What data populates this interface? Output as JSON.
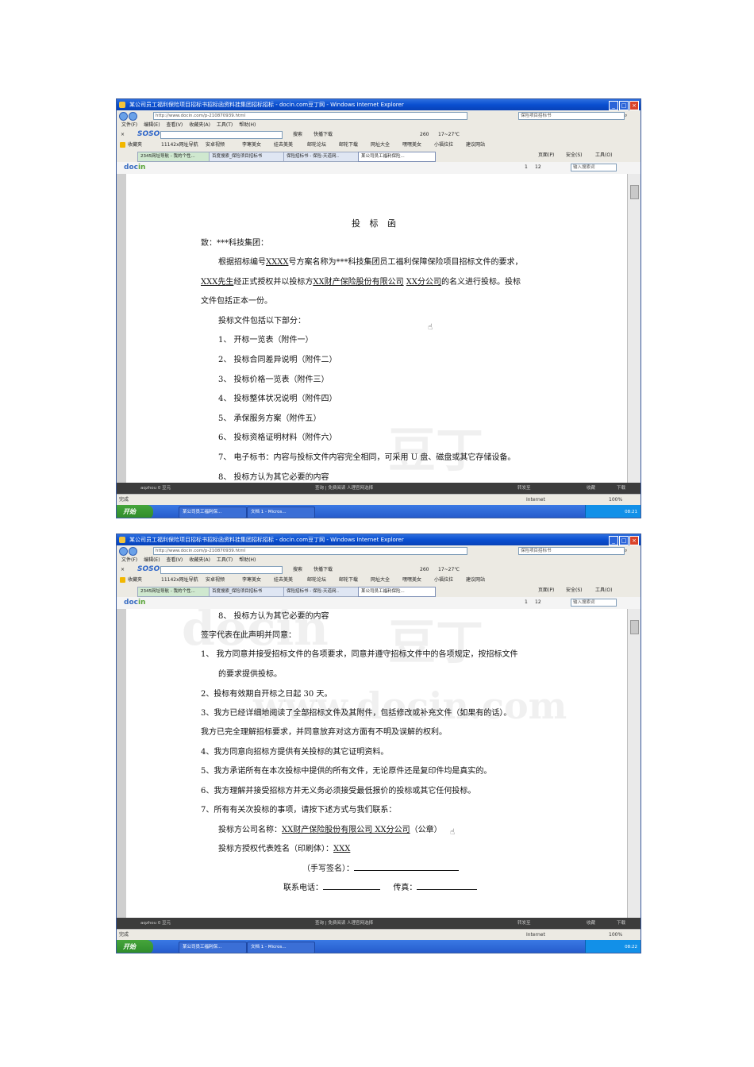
{
  "browser": {
    "title": "某公司员工福利保险项目招标书招标函资料挂集团招标招标 - docin.com豆丁网 - Windows Internet Explorer",
    "address_1": "http://www.docin.com/p-210870939.html",
    "address_2": "http://www.docin.com/p-210870939.html",
    "search_box": "保险项目招标书",
    "menus": [
      "文件(F)",
      "编辑(E)",
      "查看(V)",
      "收藏夹(A)",
      "工具(T)",
      "帮助(H)"
    ],
    "soso_search_label": "搜索",
    "soso_download_label": "快播下载",
    "weather": "17~27℃",
    "count_260": "260",
    "favorites_label": "收藏夹",
    "favorites": [
      "11142x网址导航",
      "安卓视频",
      "李寒美女",
      "娃去美美",
      "邮轮论坛",
      "邮轮下载",
      "网址大全",
      "嘿嘿美女",
      "小福拉拉",
      "建议网站"
    ],
    "tabs": [
      "2345网址导航 - 我的个性...",
      "百度搜索_保险项目招标书",
      "保险招标书 - 保险-天道网..",
      "某公司员工福利保险..."
    ],
    "page_menu": "页面(P)",
    "safety_menu": "安全(S)",
    "tools_menu": "工具(O)",
    "page_indicator_1": "1",
    "page_total": "12",
    "search_keyword_placeholder": "输入搜索词",
    "bottom_user": "aqzhou 0 豆元",
    "bottom_center": "查询 | 免费阅读 人理官网选择",
    "bottom_right_1": "转发至",
    "bottom_right_2": "收藏",
    "bottom_right_3": "下载",
    "status_done": "完成",
    "status_internet": "Internet",
    "zoom": "100%",
    "start_label": "开始",
    "task_1": "某公司员工福利保...",
    "task_2": "文档 1 - Micros...",
    "clock_1": "08:21",
    "clock_2": "08:22"
  },
  "doc_page_1": {
    "title": "投 标 函",
    "salutation": "致：***科技集团：",
    "para1_a": "根据招标编号",
    "para1_code": "XXXX",
    "para1_b": "号方案名称为***科技集团员工福利保障保险项目招标文件的要求，",
    "para2_person": "XXX先生",
    "para2_mid": "经正式授权并以投标方",
    "para2_company": "XX财产保险股份有限公司",
    "para2_branch": "XX分公司",
    "para2_end": "的名义进行投标。投标",
    "para3": "文件包括正本一份。",
    "list_intro": "投标文件包括以下部分：",
    "items": [
      "1、 开标一览表（附件一）",
      "2、 投标合同差异说明（附件二）",
      "3、 投标价格一览表（附件三）",
      "4、 投标整体状况说明（附件四）",
      "5、 承保服务方案（附件五）",
      "6、 投标资格证明材料（附件六）",
      "7、 电子标书：内容与投标文件内容完全相同，可采用 U 盘、磁盘或其它存储设备。",
      "8、 投标方认为其它必要的内容"
    ]
  },
  "doc_page_2": {
    "item8": "8、 投标方认为其它必要的内容",
    "sign_intro": "签字代表在此声明并同意：",
    "c1a": "1、 我方同意并接受招标文件的各项要求，同意并遵守招标文件中的各项规定，按招标文件",
    "c1b": "的要求提供投标。",
    "c2": "2、投标有效期自开标之日起 30 天。",
    "c3a": "3、我方已经详细地阅读了全部招标文件及其附件，包括修改或补充文件（如果有的话）。",
    "c3b": "我方已完全理解招标要求，并同意放弃对这方面有不明及误解的权利。",
    "c4": "4、我方同意向招标方提供有关投标的其它证明资料。",
    "c5": "5、我方承诺所有在本次投标中提供的所有文件，无论原件还是复印件均是真实的。",
    "c6": "6、我方理解并接受招标方并无义务必须接受最低报价的投标或其它任何投标。",
    "c7": "7、所有有关次投标的事项，请按下述方式与我们联系：",
    "company_label": "投标方公司名称：",
    "company_value": "XX财产保险股份有限公司 XX分公司",
    "company_seal": "（公章）",
    "rep_label": "投标方授权代表姓名（印刷体）：",
    "rep_value": "XXX",
    "signature_label": "（手写签名）：",
    "phone_label": "联系电话：",
    "fax_label": "传真："
  },
  "watermark": {
    "brand": "docin",
    "cn": "豆丁",
    "url": "www.docin.com"
  }
}
